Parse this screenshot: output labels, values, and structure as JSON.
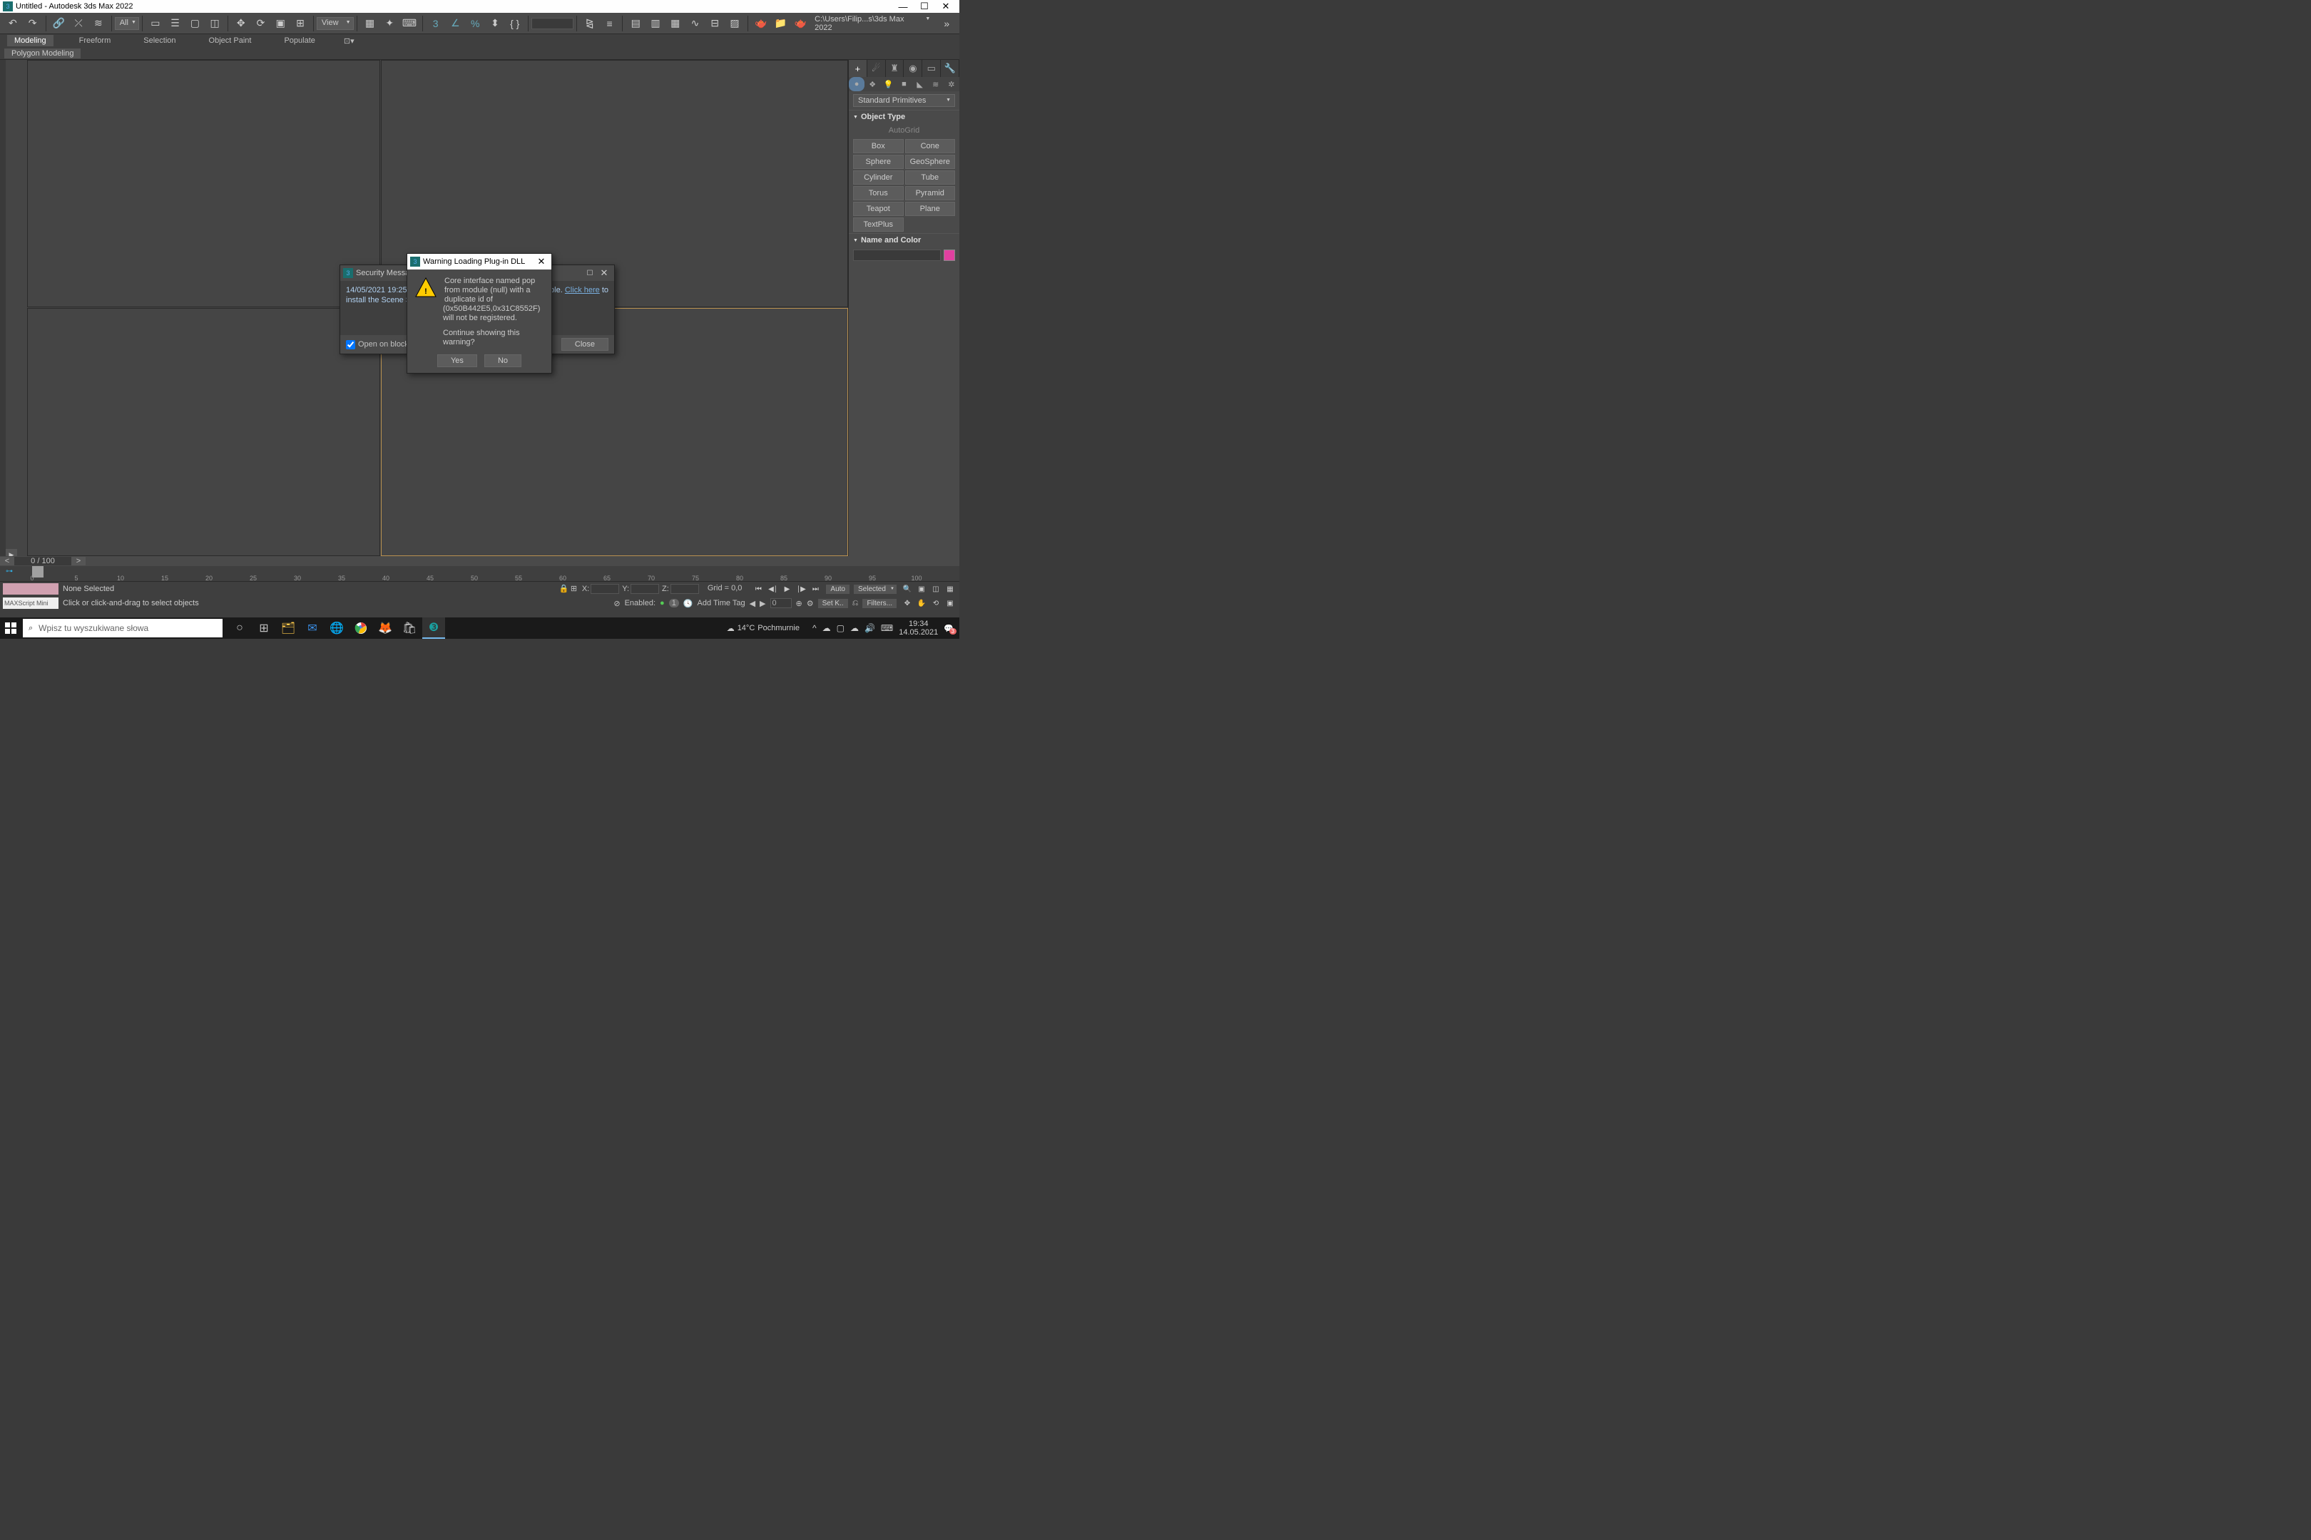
{
  "titlebar": {
    "title": "Untitled - Autodesk 3ds Max 2022"
  },
  "toolbar": {
    "selection_filter": "All",
    "view_label": "View",
    "path": "C:\\Users\\Filip...s\\3ds Max 2022"
  },
  "ribbon": {
    "tabs": [
      "Modeling",
      "Freeform",
      "Selection",
      "Object Paint",
      "Populate"
    ],
    "sub": "Polygon Modeling"
  },
  "cmd": {
    "category": "Standard Primitives",
    "rollout_type": "Object Type",
    "autogrid": "AutoGrid",
    "buttons": [
      "Box",
      "Cone",
      "Sphere",
      "GeoSphere",
      "Cylinder",
      "Tube",
      "Torus",
      "Pyramid",
      "Teapot",
      "Plane",
      "TextPlus"
    ],
    "rollout_name": "Name and Color"
  },
  "sec_dialog": {
    "title": "Security Messag",
    "line1": "14/05/2021 19:25:08 - ",
    "line2": "install the Scene Secu",
    "avail": "ailable. ",
    "click": "Click here",
    "to": " to",
    "checkbox": "Open on blocked c",
    "close": "Close"
  },
  "warn_dialog": {
    "title": "Warning Loading Plug-in DLL",
    "msg": "Core interface named pop from module (null) with a duplicate id of (0x50B442E5,0x31C8552F) will not be registered.",
    "cont": "Continue showing this warning?",
    "yes": "Yes",
    "no": "No"
  },
  "bottom": {
    "frame": "0 / 100",
    "ticks": [
      "0",
      "5",
      "10",
      "15",
      "20",
      "25",
      "30",
      "35",
      "40",
      "45",
      "50",
      "55",
      "60",
      "65",
      "70",
      "75",
      "80",
      "85",
      "90",
      "95",
      "100"
    ],
    "none_sel": "None Selected",
    "hint": "Click or click-and-drag to select objects",
    "maxscript": "MAXScript Mini",
    "x": "X:",
    "y": "Y:",
    "z": "Z:",
    "grid": "Grid = 0,0",
    "auto": "Auto",
    "selected": "Selected",
    "setk": "Set K..",
    "filters": "Filters...",
    "enabled": "Enabled:",
    "one": "1",
    "addtag": "Add Time Tag",
    "spin": "0"
  },
  "taskbar": {
    "search": "Wpisz tu wyszukiwane słowa",
    "weather_temp": "14°C",
    "weather_txt": "Pochmurnie",
    "time": "19:34",
    "date": "14.05.2021",
    "notif": "3"
  }
}
